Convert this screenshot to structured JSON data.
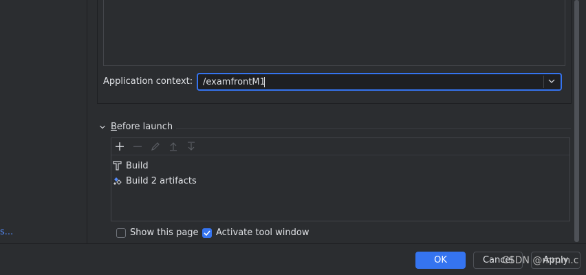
{
  "left_panel": {
    "link_text": "s..."
  },
  "context": {
    "label": "Application context:",
    "value": "/examfrontM1",
    "dropdown_icon": "chevron-down-icon"
  },
  "before_launch": {
    "title_first_letter": "B",
    "title_rest": "efore launch",
    "toolbar": [
      {
        "icon": "add-icon",
        "enabled": true
      },
      {
        "icon": "remove-icon",
        "enabled": false
      },
      {
        "icon": "edit-icon",
        "enabled": false
      },
      {
        "icon": "move-up-icon",
        "enabled": false
      },
      {
        "icon": "move-down-icon",
        "enabled": false
      }
    ],
    "items": [
      {
        "icon": "build-hammer-icon",
        "label": "Build"
      },
      {
        "icon": "artifacts-icon",
        "label": "Build 2 artifacts"
      }
    ]
  },
  "options": {
    "show_this_page": {
      "label": "Show this page",
      "checked": false
    },
    "activate_tool_window": {
      "label": "Activate tool window",
      "checked": true
    }
  },
  "footer": {
    "ok_label": "OK",
    "cancel_label": "Cancel",
    "apply_label": "Apply"
  },
  "watermark": "CSDN @mmm.c",
  "colors": {
    "accent": "#3574f0",
    "background": "#2b2d30",
    "field_bg": "#1e1f22",
    "link": "#548af7"
  }
}
